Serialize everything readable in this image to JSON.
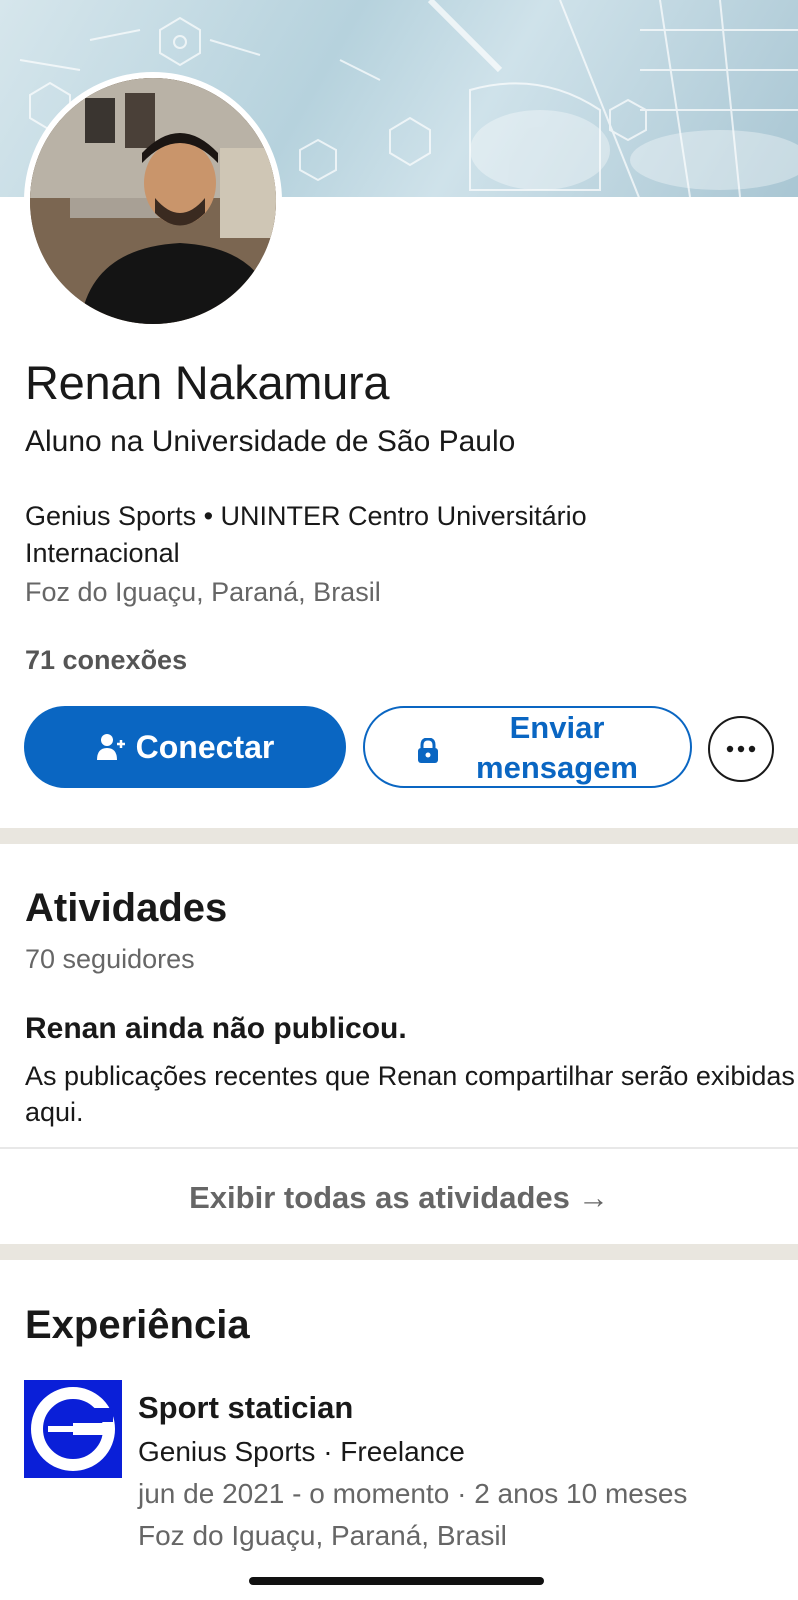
{
  "profile": {
    "name": "Renan Nakamura",
    "headline": "Aluno na Universidade de São Paulo",
    "companies": "Genius Sports • UNINTER Centro Universitário Internacional",
    "location": "Foz do Iguaçu, Paraná, Brasil",
    "connections": "71 conexões"
  },
  "actions": {
    "connect_label": "Conectar",
    "message_label": "Enviar mensagem",
    "more_icon": "more-horizontal-icon"
  },
  "activity": {
    "title": "Atividades",
    "followers": "70 seguidores",
    "empty_title": "Renan ainda não publicou.",
    "empty_desc": "As publicações recentes que Renan compartilhar serão exibidas aqui.",
    "show_all": "Exibir todas as atividades",
    "show_all_arrow": "→"
  },
  "experience": {
    "title": "Experiência",
    "items": [
      {
        "role": "Sport statician",
        "company": "Genius Sports · Freelance",
        "dates": "jun de 2021 - o momento · 2 anos 10 meses",
        "location": "Foz do Iguaçu, Paraná, Brasil"
      }
    ]
  },
  "colors": {
    "primary": "#0a66c2",
    "logo_blue": "#0a1fd8",
    "divider": "#e9e6df"
  }
}
